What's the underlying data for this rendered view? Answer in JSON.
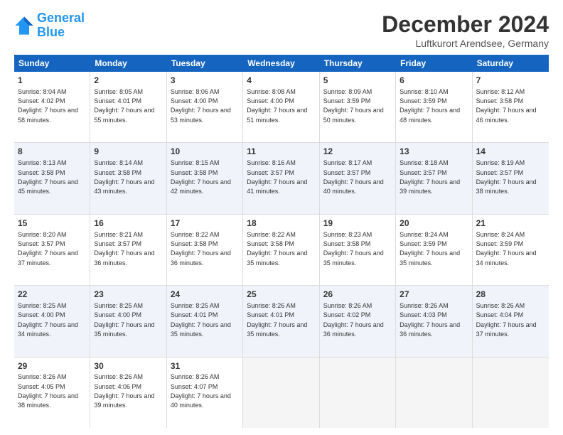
{
  "logo": {
    "line1": "General",
    "line2": "Blue"
  },
  "title": "December 2024",
  "location": "Luftkurort Arendsee, Germany",
  "header": {
    "days": [
      "Sunday",
      "Monday",
      "Tuesday",
      "Wednesday",
      "Thursday",
      "Friday",
      "Saturday"
    ]
  },
  "rows": [
    {
      "alt": false,
      "cells": [
        {
          "day": "1",
          "rise": "Sunrise: 8:04 AM",
          "set": "Sunset: 4:02 PM",
          "daylight": "Daylight: 7 hours and 58 minutes."
        },
        {
          "day": "2",
          "rise": "Sunrise: 8:05 AM",
          "set": "Sunset: 4:01 PM",
          "daylight": "Daylight: 7 hours and 55 minutes."
        },
        {
          "day": "3",
          "rise": "Sunrise: 8:06 AM",
          "set": "Sunset: 4:00 PM",
          "daylight": "Daylight: 7 hours and 53 minutes."
        },
        {
          "day": "4",
          "rise": "Sunrise: 8:08 AM",
          "set": "Sunset: 4:00 PM",
          "daylight": "Daylight: 7 hours and 51 minutes."
        },
        {
          "day": "5",
          "rise": "Sunrise: 8:09 AM",
          "set": "Sunset: 3:59 PM",
          "daylight": "Daylight: 7 hours and 50 minutes."
        },
        {
          "day": "6",
          "rise": "Sunrise: 8:10 AM",
          "set": "Sunset: 3:59 PM",
          "daylight": "Daylight: 7 hours and 48 minutes."
        },
        {
          "day": "7",
          "rise": "Sunrise: 8:12 AM",
          "set": "Sunset: 3:58 PM",
          "daylight": "Daylight: 7 hours and 46 minutes."
        }
      ]
    },
    {
      "alt": true,
      "cells": [
        {
          "day": "8",
          "rise": "Sunrise: 8:13 AM",
          "set": "Sunset: 3:58 PM",
          "daylight": "Daylight: 7 hours and 45 minutes."
        },
        {
          "day": "9",
          "rise": "Sunrise: 8:14 AM",
          "set": "Sunset: 3:58 PM",
          "daylight": "Daylight: 7 hours and 43 minutes."
        },
        {
          "day": "10",
          "rise": "Sunrise: 8:15 AM",
          "set": "Sunset: 3:58 PM",
          "daylight": "Daylight: 7 hours and 42 minutes."
        },
        {
          "day": "11",
          "rise": "Sunrise: 8:16 AM",
          "set": "Sunset: 3:57 PM",
          "daylight": "Daylight: 7 hours and 41 minutes."
        },
        {
          "day": "12",
          "rise": "Sunrise: 8:17 AM",
          "set": "Sunset: 3:57 PM",
          "daylight": "Daylight: 7 hours and 40 minutes."
        },
        {
          "day": "13",
          "rise": "Sunrise: 8:18 AM",
          "set": "Sunset: 3:57 PM",
          "daylight": "Daylight: 7 hours and 39 minutes."
        },
        {
          "day": "14",
          "rise": "Sunrise: 8:19 AM",
          "set": "Sunset: 3:57 PM",
          "daylight": "Daylight: 7 hours and 38 minutes."
        }
      ]
    },
    {
      "alt": false,
      "cells": [
        {
          "day": "15",
          "rise": "Sunrise: 8:20 AM",
          "set": "Sunset: 3:57 PM",
          "daylight": "Daylight: 7 hours and 37 minutes."
        },
        {
          "day": "16",
          "rise": "Sunrise: 8:21 AM",
          "set": "Sunset: 3:57 PM",
          "daylight": "Daylight: 7 hours and 36 minutes."
        },
        {
          "day": "17",
          "rise": "Sunrise: 8:22 AM",
          "set": "Sunset: 3:58 PM",
          "daylight": "Daylight: 7 hours and 36 minutes."
        },
        {
          "day": "18",
          "rise": "Sunrise: 8:22 AM",
          "set": "Sunset: 3:58 PM",
          "daylight": "Daylight: 7 hours and 35 minutes."
        },
        {
          "day": "19",
          "rise": "Sunrise: 8:23 AM",
          "set": "Sunset: 3:58 PM",
          "daylight": "Daylight: 7 hours and 35 minutes."
        },
        {
          "day": "20",
          "rise": "Sunrise: 8:24 AM",
          "set": "Sunset: 3:59 PM",
          "daylight": "Daylight: 7 hours and 35 minutes."
        },
        {
          "day": "21",
          "rise": "Sunrise: 8:24 AM",
          "set": "Sunset: 3:59 PM",
          "daylight": "Daylight: 7 hours and 34 minutes."
        }
      ]
    },
    {
      "alt": true,
      "cells": [
        {
          "day": "22",
          "rise": "Sunrise: 8:25 AM",
          "set": "Sunset: 4:00 PM",
          "daylight": "Daylight: 7 hours and 34 minutes."
        },
        {
          "day": "23",
          "rise": "Sunrise: 8:25 AM",
          "set": "Sunset: 4:00 PM",
          "daylight": "Daylight: 7 hours and 35 minutes."
        },
        {
          "day": "24",
          "rise": "Sunrise: 8:25 AM",
          "set": "Sunset: 4:01 PM",
          "daylight": "Daylight: 7 hours and 35 minutes."
        },
        {
          "day": "25",
          "rise": "Sunrise: 8:26 AM",
          "set": "Sunset: 4:01 PM",
          "daylight": "Daylight: 7 hours and 35 minutes."
        },
        {
          "day": "26",
          "rise": "Sunrise: 8:26 AM",
          "set": "Sunset: 4:02 PM",
          "daylight": "Daylight: 7 hours and 36 minutes."
        },
        {
          "day": "27",
          "rise": "Sunrise: 8:26 AM",
          "set": "Sunset: 4:03 PM",
          "daylight": "Daylight: 7 hours and 36 minutes."
        },
        {
          "day": "28",
          "rise": "Sunrise: 8:26 AM",
          "set": "Sunset: 4:04 PM",
          "daylight": "Daylight: 7 hours and 37 minutes."
        }
      ]
    },
    {
      "alt": false,
      "cells": [
        {
          "day": "29",
          "rise": "Sunrise: 8:26 AM",
          "set": "Sunset: 4:05 PM",
          "daylight": "Daylight: 7 hours and 38 minutes."
        },
        {
          "day": "30",
          "rise": "Sunrise: 8:26 AM",
          "set": "Sunset: 4:06 PM",
          "daylight": "Daylight: 7 hours and 39 minutes."
        },
        {
          "day": "31",
          "rise": "Sunrise: 8:26 AM",
          "set": "Sunset: 4:07 PM",
          "daylight": "Daylight: 7 hours and 40 minutes."
        },
        {
          "day": "",
          "rise": "",
          "set": "",
          "daylight": ""
        },
        {
          "day": "",
          "rise": "",
          "set": "",
          "daylight": ""
        },
        {
          "day": "",
          "rise": "",
          "set": "",
          "daylight": ""
        },
        {
          "day": "",
          "rise": "",
          "set": "",
          "daylight": ""
        }
      ]
    }
  ]
}
